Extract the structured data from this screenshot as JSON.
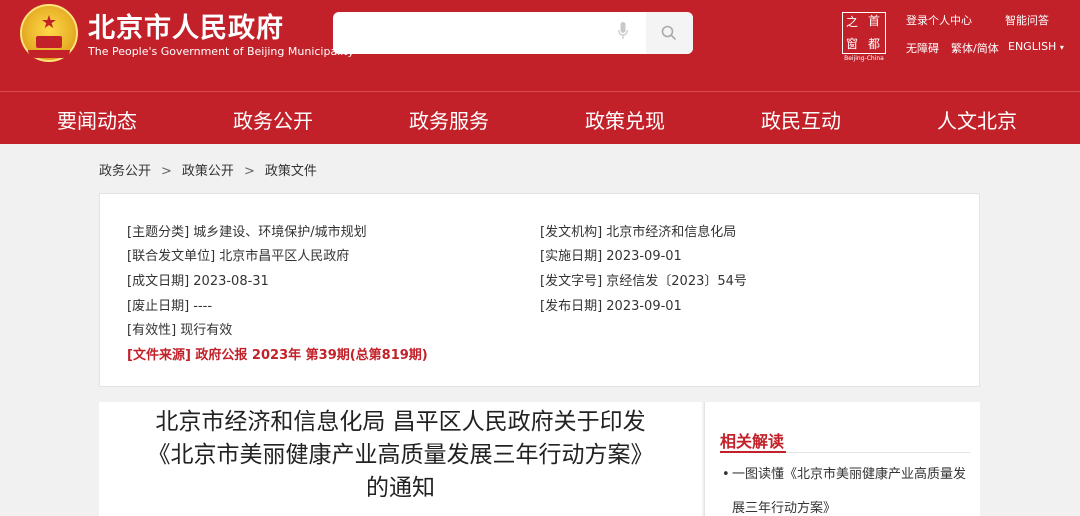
{
  "header": {
    "site_title_cn": "北京市人民政府",
    "site_title_en": "The People's Government of Beijing Municipality",
    "search": {
      "value": "",
      "placeholder": ""
    },
    "logo": {
      "chars": [
        "之",
        "首",
        "窗",
        "都"
      ],
      "caption": "Beijing-China"
    },
    "links": {
      "login": "登录个人中心",
      "smart_qa": "智能问答",
      "accessibility": "无障碍",
      "trad_simp": "繁体/简体",
      "english": "ENGLISH",
      "english_arrow": "▾"
    }
  },
  "nav": [
    "要闻动态",
    "政务公开",
    "政务服务",
    "政策兑现",
    "政民互动",
    "人文北京"
  ],
  "breadcrumb": [
    "政务公开",
    "政策公开",
    "政策文件"
  ],
  "breadcrumb_sep": ">",
  "info": {
    "left": [
      "[主题分类] 城乡建设、环境保护/城市规划",
      "[联合发文单位] 北京市昌平区人民政府",
      "[成文日期] 2023-08-31",
      "[废止日期] ----",
      "[有效性] 现行有效"
    ],
    "source": "[文件来源] 政府公报 2023年 第39期(总第819期)",
    "right": [
      "[发文机构] 北京市经济和信息化局",
      "[实施日期] 2023-09-01",
      "[发文字号] 京经信发〔2023〕54号",
      "[发布日期] 2023-09-01"
    ]
  },
  "article": {
    "title_lines": [
      "北京市经济和信息化局 昌平区人民政府关于印发",
      "《北京市美丽健康产业高质量发展三年行动方案》",
      "的通知"
    ]
  },
  "sidebar": {
    "title": "相关解读",
    "items": [
      "一图读懂《北京市美丽健康产业高质量发展三年行动方案》"
    ]
  },
  "colors": {
    "brand_red": "#c3212a",
    "page_bg": "#f1f1f1"
  }
}
